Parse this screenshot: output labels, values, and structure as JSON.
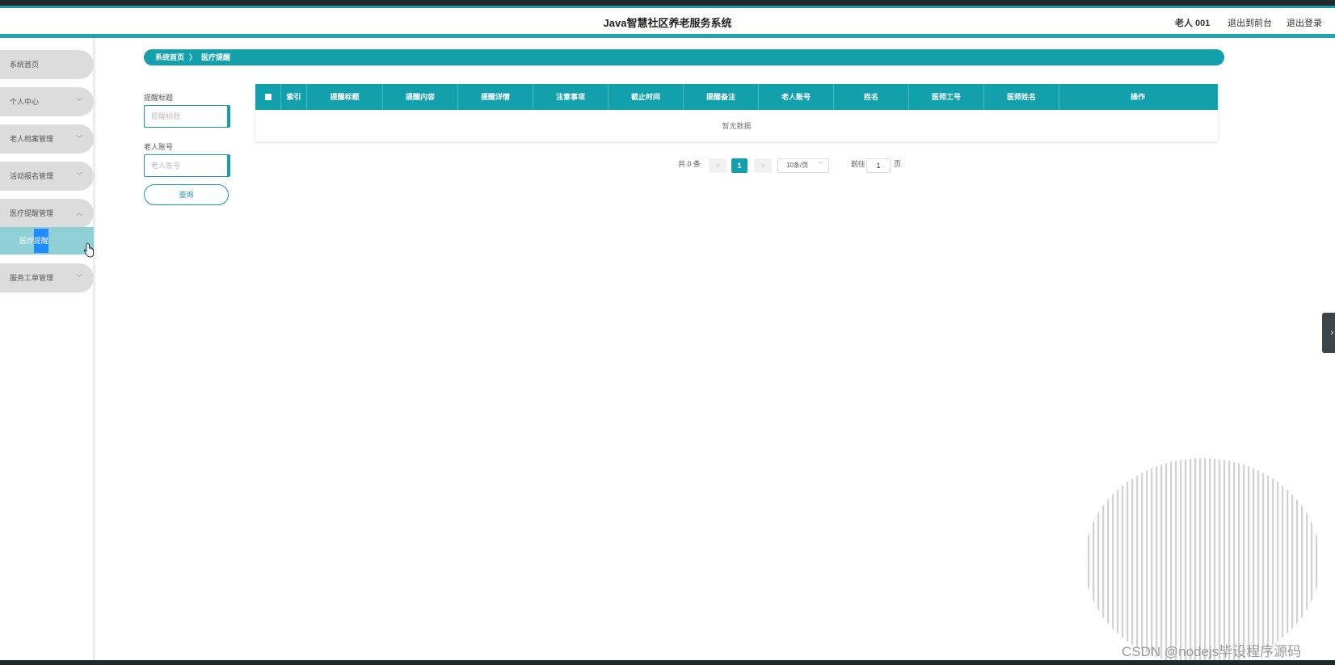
{
  "header": {
    "title": "Java智慧社区养老服务系统",
    "user": "老人 001",
    "links": [
      "退出到前台",
      "退出登录"
    ]
  },
  "sidebar": {
    "items": [
      {
        "label": "系统首页",
        "chevron": ""
      },
      {
        "label": "个人中心",
        "chevron": "﹀"
      },
      {
        "label": "老人档案管理",
        "chevron": "﹀"
      },
      {
        "label": "活动报名管理",
        "chevron": "﹀"
      },
      {
        "label": "医疗提醒管理",
        "chevron": "︿"
      },
      {
        "label": "服务工单管理",
        "chevron": "﹀"
      }
    ],
    "sub_item_prefix": "医疗",
    "sub_item_highlight": "提醒"
  },
  "breadcrumb": {
    "home": "系统首页",
    "separator": "〉",
    "current": "医疗提醒"
  },
  "search": {
    "field1_label": "提醒标题",
    "field1_placeholder": "提醒标题",
    "field2_label": "老人账号",
    "field2_placeholder": "老人账号",
    "query_label": "查询"
  },
  "table": {
    "columns": [
      "索引",
      "提醒标题",
      "提醒内容",
      "提醒详情",
      "注意事项",
      "截止时间",
      "提醒备注",
      "老人账号",
      "姓名",
      "医师工号",
      "医师姓名",
      "操作"
    ],
    "empty_text": "暂无数据"
  },
  "pagination": {
    "total_text": "共 0 条",
    "prev": "<",
    "current_page": "1",
    "next": ">",
    "page_size": "10条/页",
    "goto_label": "前往",
    "goto_value": "1",
    "page_suffix": "页"
  },
  "toggle_icon": "›",
  "watermark": "CSDN @nodejs毕设程序源码",
  "colors": {
    "accent": "#13a0ad",
    "sidebar_item": "#dcdcdc",
    "sidebar_active": "#8fd0d7",
    "highlight": "#1f8bff"
  }
}
